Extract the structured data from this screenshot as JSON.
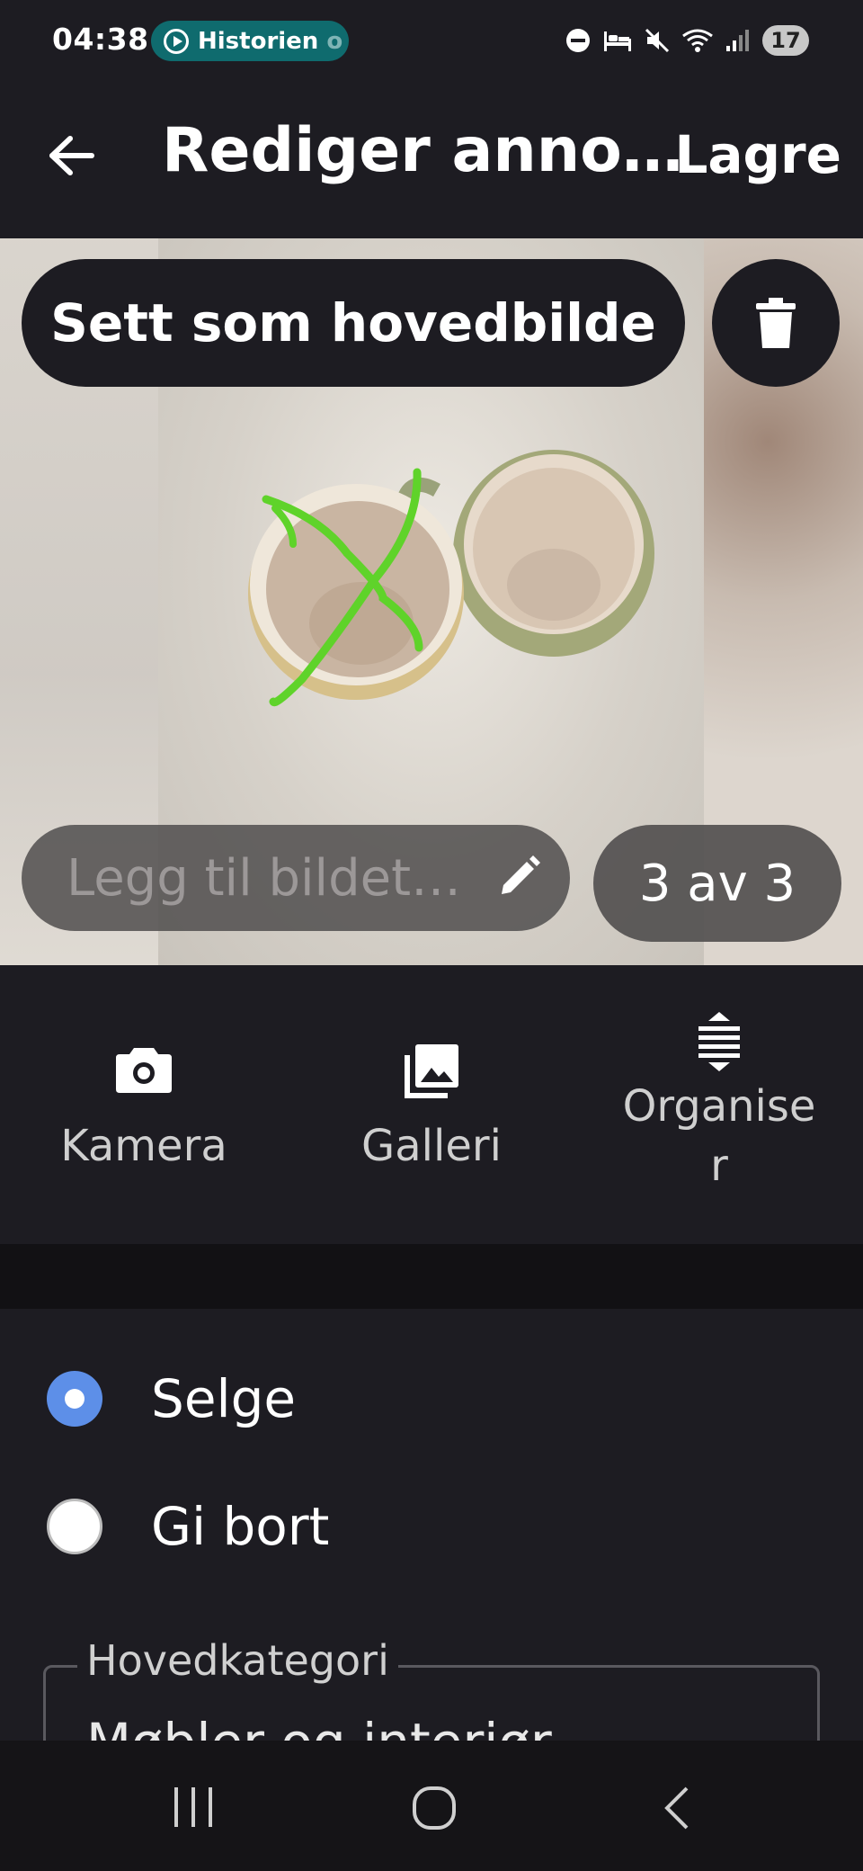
{
  "status_bar": {
    "time": "04:38",
    "now_playing": "Historien",
    "now_playing_fade": "o",
    "battery": "17"
  },
  "app_bar": {
    "title": "Rediger anno…",
    "save_label": "Lagre"
  },
  "image_editor": {
    "set_main_label": "Sett som hovedbilde",
    "caption_placeholder": "Legg til bildet…",
    "counter": "3 av 3"
  },
  "actions": [
    {
      "label": "Kamera",
      "icon": "camera-icon"
    },
    {
      "label": "Galleri",
      "icon": "gallery-icon"
    },
    {
      "label_line1": "Organise",
      "label_line2": "r",
      "icon": "reorder-icon"
    }
  ],
  "listing_type": {
    "options": [
      {
        "label": "Selge",
        "selected": true
      },
      {
        "label": "Gi bort",
        "selected": false
      }
    ]
  },
  "category": {
    "label": "Hovedkategori",
    "value": "Møbler og interiør"
  },
  "colors": {
    "background": "#1d1c22",
    "radio_selected": "#5d8fe8",
    "pill": "#0f6b6e",
    "photo_annotation": "#5fd32a"
  }
}
